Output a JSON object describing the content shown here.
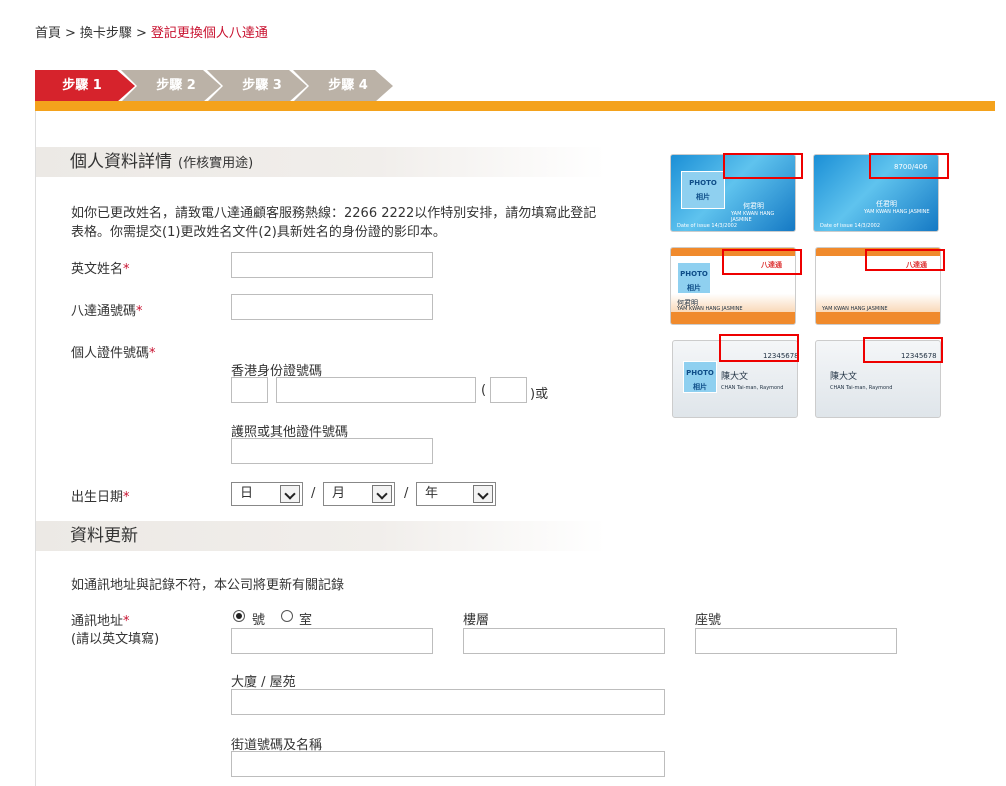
{
  "breadcrumb": {
    "home": "首頁",
    "sep": ">",
    "step": "換卡步驟",
    "current": "登記更換個人八達通"
  },
  "steps": [
    {
      "label": "步驟 1",
      "active": true
    },
    {
      "label": "步驟 2",
      "active": false
    },
    {
      "label": "步驟 3",
      "active": false
    },
    {
      "label": "步驟 4",
      "active": false
    }
  ],
  "colors": {
    "accent": "#d6232c",
    "orange": "#f4a21c",
    "step_inactive": "#bbb2a7"
  },
  "personal": {
    "title": "個人資料詳情",
    "title_note": "(作核實用途)",
    "intro_line1": "如你已更改姓名，請致電八達通顧客服務熱線：2266 2222以作特別安排，請勿填寫此登記",
    "intro_line2": "表格。你需提交(1)更改姓名文件(2)具新姓名的身份證的影印本。",
    "english_name_label": "英文姓名",
    "octopus_no_label": "八達通號碼",
    "id_label": "個人證件號碼",
    "hkid_label": "香港身份證號碼",
    "paren_open": "(",
    "paren_close_or": ")或",
    "passport_label": "護照或其他證件號碼",
    "dob_label": "出生日期",
    "day": "日",
    "month": "月",
    "year": "年",
    "slash": "/",
    "required_mark": "*"
  },
  "update": {
    "title": "資料更新",
    "intro": "如通訊地址與記錄不符，本公司將更新有關記錄",
    "address_label": "通訊地址",
    "address_note": "(請以英文填寫)",
    "radio_flat": "號",
    "radio_room": "室",
    "floor_label": "樓層",
    "block_label": "座號",
    "building_label": "大廈 / 屋苑",
    "street_label": "街道號碼及名稱"
  },
  "cards": {
    "photo": "PHOTO",
    "photo_cn": "相片",
    "name_cn_1": "何君明",
    "name_cn_2": "任君明",
    "name_en": "YAM KWAN HANG JASMINE",
    "issue": "Date of issue  14/3/2002",
    "card_no": "8700/406",
    "chan_cn": "陳大文",
    "chan_en": "CHAN Tai-man, Raymond",
    "chan_no": "12345678",
    "brand": "八達通"
  }
}
